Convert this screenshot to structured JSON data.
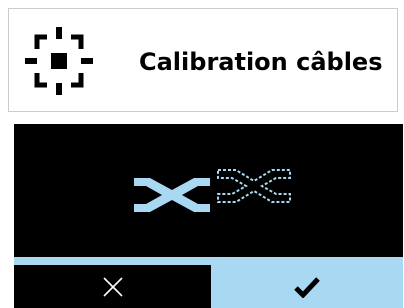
{
  "header": {
    "title": "Calibration câbles",
    "icon": "target-crosshair-icon"
  },
  "screen": {
    "illustration": "cable-crossing-icon",
    "buttons": {
      "cancel_icon": "close-icon",
      "confirm_icon": "checkmark-icon"
    }
  },
  "colors": {
    "accent": "#a9d8f3",
    "screen_background": "#000000",
    "header_border": "#cccccc"
  }
}
